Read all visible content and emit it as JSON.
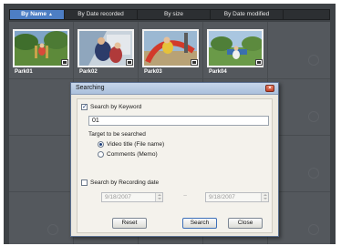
{
  "sort_tabs": [
    {
      "label": "By Name",
      "active": true
    },
    {
      "label": "By Date recorded",
      "active": false
    },
    {
      "label": "By size",
      "active": false
    },
    {
      "label": "By Date modified",
      "active": false
    }
  ],
  "thumbnails": [
    {
      "caption": "Park01",
      "selected": false
    },
    {
      "caption": "Park02",
      "selected": false
    },
    {
      "caption": "Park03",
      "selected": false
    },
    {
      "caption": "Park04",
      "selected": false
    }
  ],
  "dialog": {
    "title": "Searching",
    "close_icon": "close-icon",
    "keyword": {
      "label": "Search by Keyword",
      "checked": true,
      "value": "01"
    },
    "target": {
      "heading": "Target to be searched",
      "options": [
        {
          "label": "Video title (File name)",
          "checked": true
        },
        {
          "label": "Comments (Memo)",
          "checked": false
        }
      ]
    },
    "recording_date": {
      "label": "Search by Recording date",
      "checked": false,
      "from": "9/18/2007",
      "to": "9/18/2007",
      "separator": "~"
    },
    "buttons": {
      "reset": "Reset",
      "search": "Search",
      "close": "Close"
    }
  },
  "colors": {
    "accent": "#4d7ec4",
    "background": "#3e4246"
  }
}
